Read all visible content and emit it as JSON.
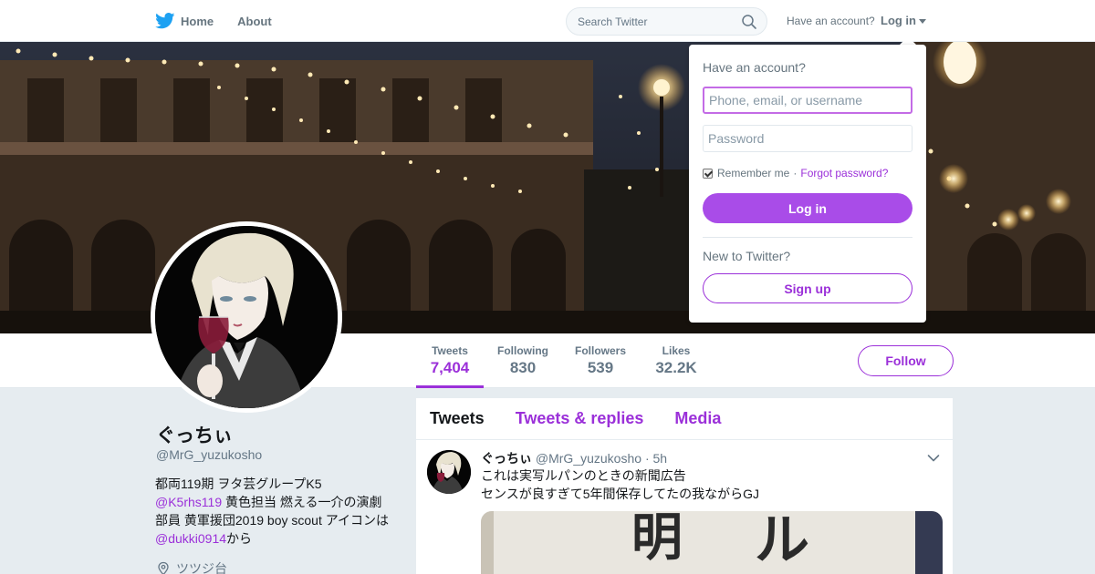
{
  "topnav": {
    "home_label": "Home",
    "about_label": "About",
    "search_placeholder": "Search Twitter",
    "have_account_label": "Have an account?",
    "login_label": "Log in"
  },
  "profile": {
    "name": "ぐっちぃ",
    "handle": "@MrG_yuzukosho",
    "bio": {
      "line1": "都両119期 ヲタ芸グループK5",
      "mention1": "@K5rhs119",
      "text2": " 黄色担当 燃える一介の演劇部員 黄軍援団2019 boy scout アイコンは",
      "mention2": "@dukki0914",
      "text3": "から"
    },
    "location": "ツツジ台"
  },
  "stats": [
    {
      "label": "Tweets",
      "value": "7,404"
    },
    {
      "label": "Following",
      "value": "830"
    },
    {
      "label": "Followers",
      "value": "539"
    },
    {
      "label": "Likes",
      "value": "32.2K"
    }
  ],
  "follow_label": "Follow",
  "timeline": {
    "tabs": [
      "Tweets",
      "Tweets & replies",
      "Media"
    ],
    "tweet": {
      "name": "ぐっちぃ",
      "handle": "@MrG_yuzukosho",
      "dot": "·",
      "time": "5h",
      "line1": "これは実写ルパンのときの新聞広告",
      "line2": "センスが良すぎて5年間保存してたの我ながらGJ",
      "media_glyph_1": "明",
      "media_glyph_2": "ル"
    }
  },
  "login_dropdown": {
    "title": "Have an account?",
    "username_placeholder": "Phone, email, or username",
    "password_placeholder": "Password",
    "remember_label": "Remember me",
    "separator": "·",
    "forgot_label": "Forgot password?",
    "login_button": "Log in",
    "new_label": "New to Twitter?",
    "signup_button": "Sign up"
  },
  "colors": {
    "accent": "#9b30d9",
    "login_button": "#a94ce8",
    "twitter_blue": "#1da1f2"
  }
}
